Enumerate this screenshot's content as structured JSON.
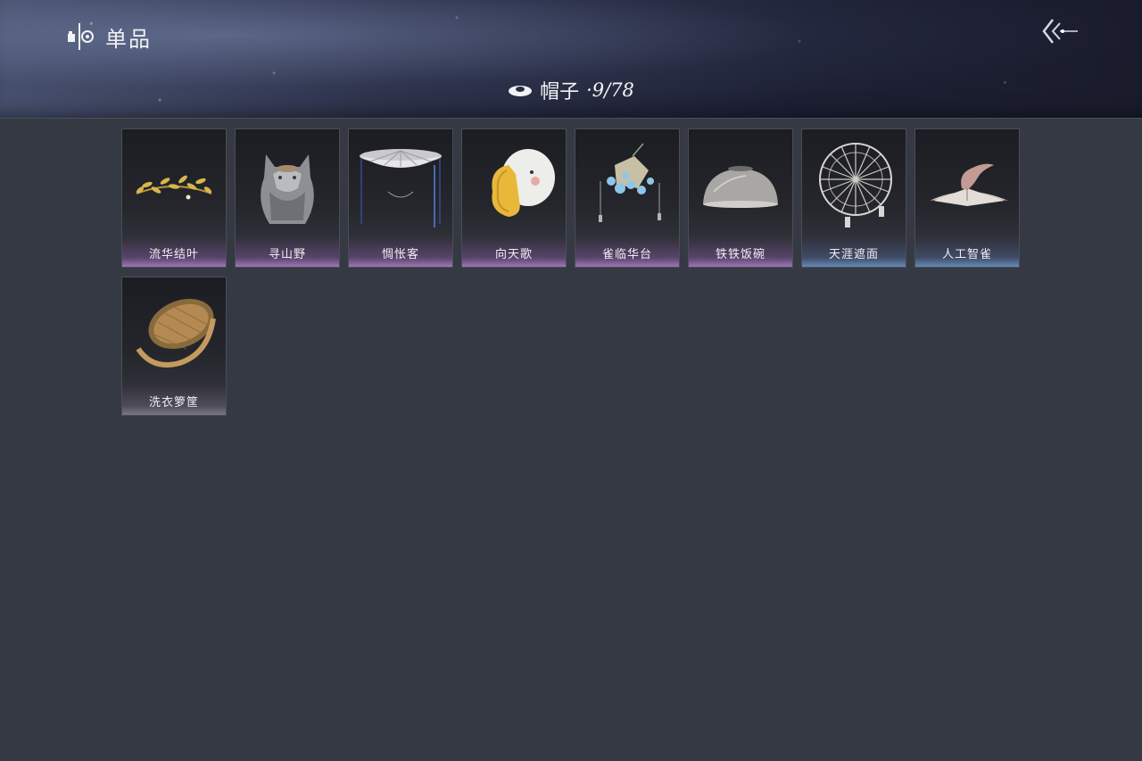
{
  "header": {
    "section_label": "单品",
    "section_icon": "outfit-icon",
    "back_icon": "back-arrow-icon"
  },
  "category": {
    "icon": "hat-icon",
    "label": "帽子",
    "count": "·9/78"
  },
  "items": [
    {
      "name": "流华结叶",
      "icon": "laurel-crown-icon",
      "rarity_color": "#b48ad2"
    },
    {
      "name": "寻山野",
      "icon": "wolf-hood-icon",
      "rarity_color": "#b48ad2"
    },
    {
      "name": "惆怅客",
      "icon": "veiled-bamboo-hat-icon",
      "rarity_color": "#b48ad2"
    },
    {
      "name": "向天歌",
      "icon": "goose-hat-icon",
      "rarity_color": "#b48ad2"
    },
    {
      "name": "雀临华台",
      "icon": "flower-hairpiece-icon",
      "rarity_color": "#b48ad2"
    },
    {
      "name": "铁铁饭碗",
      "icon": "iron-bowl-hat-icon",
      "rarity_color": "#b48ad2"
    },
    {
      "name": "天涯遮面",
      "icon": "umbrella-frame-icon",
      "rarity_color": "#6ea0d2"
    },
    {
      "name": "人工智雀",
      "icon": "bird-hat-icon",
      "rarity_color": "#6ea0d2"
    },
    {
      "name": "洗衣箩筐",
      "icon": "wicker-basket-icon",
      "rarity_color": "#a0a5af"
    }
  ]
}
